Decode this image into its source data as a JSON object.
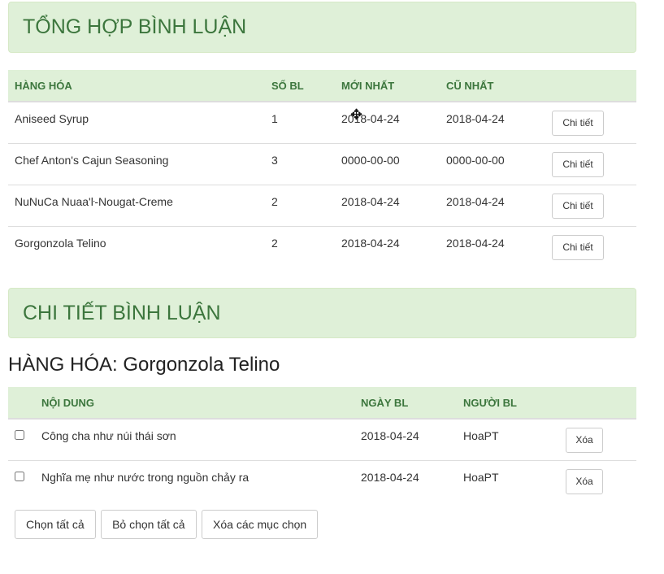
{
  "summary": {
    "title": "TỔNG HỢP BÌNH LUẬN",
    "columns": [
      "HÀNG HÓA",
      "SỐ BL",
      "MỚI NHẤT",
      "CŨ NHẤT"
    ],
    "rows": [
      {
        "name": "Aniseed Syrup",
        "count": "1",
        "newest": "2018-04-24",
        "oldest": "2018-04-24",
        "button": "Chi tiết"
      },
      {
        "name": "Chef Anton's Cajun Seasoning",
        "count": "3",
        "newest": "0000-00-00",
        "oldest": "0000-00-00",
        "button": "Chi tiết"
      },
      {
        "name": "NuNuCa Nuaa'ŀ-Nougat-Creme",
        "count": "2",
        "newest": "2018-04-24",
        "oldest": "2018-04-24",
        "button": "Chi tiết"
      },
      {
        "name": "Gorgonzola Telino",
        "count": "2",
        "newest": "2018-04-24",
        "oldest": "2018-04-24",
        "button": "Chi tiết"
      }
    ]
  },
  "detail": {
    "title": "CHI TIẾT BÌNH LUẬN",
    "product_heading": "HÀNG HÓA: Gorgonzola Telino",
    "columns": [
      "NỘI DUNG",
      "NGÀY BL",
      "NGƯỜI BL"
    ],
    "rows": [
      {
        "content": "Công cha như núi thái sơn",
        "date": "2018-04-24",
        "user": "HoaPT",
        "button": "Xóa"
      },
      {
        "content": "Nghĩa mẹ như nước trong nguồn chảy ra",
        "date": "2018-04-24",
        "user": "HoaPT",
        "button": "Xóa"
      }
    ],
    "actions": {
      "select_all": "Chọn tất cả",
      "deselect_all": "Bỏ chọn tất cả",
      "delete_selected": "Xóa các mục chọn"
    }
  },
  "colors": {
    "panel_bg": "#dff0d8",
    "panel_text": "#3c763d"
  }
}
